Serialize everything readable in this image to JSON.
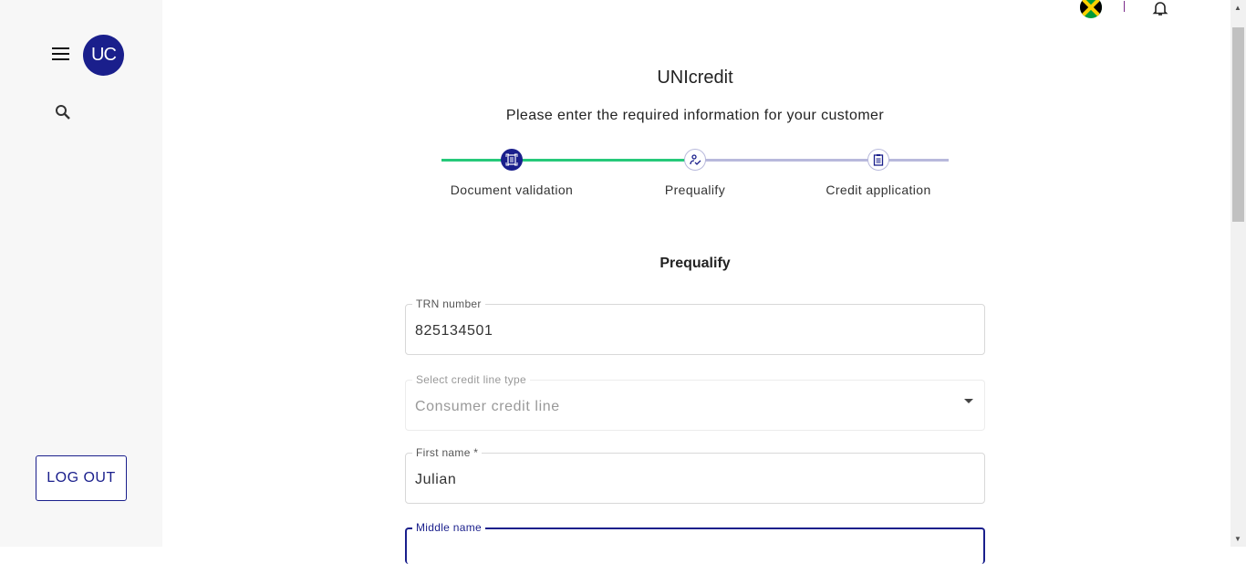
{
  "sidebar": {
    "avatar": "UC",
    "logout": "LOG OUT"
  },
  "header": {
    "title": "UNIcredit",
    "subtitle": "Please enter the required information for your customer"
  },
  "stepper": {
    "steps": [
      {
        "label": "Document validation",
        "state": "complete"
      },
      {
        "label": "Prequalify",
        "state": "active"
      },
      {
        "label": "Credit application",
        "state": "pending"
      }
    ],
    "colors": {
      "done": "#26c97a",
      "pending": "#b8b9dc",
      "primary": "#1a1f8c"
    }
  },
  "form": {
    "section_title": "Prequalify",
    "trn": {
      "label": "TRN number",
      "value": "825134501"
    },
    "credit_type": {
      "label": "Select credit line type",
      "value": "Consumer credit line"
    },
    "first_name": {
      "label": "First name *",
      "value": "Julian"
    },
    "middle_name": {
      "label": "Middle name",
      "value": ""
    }
  }
}
